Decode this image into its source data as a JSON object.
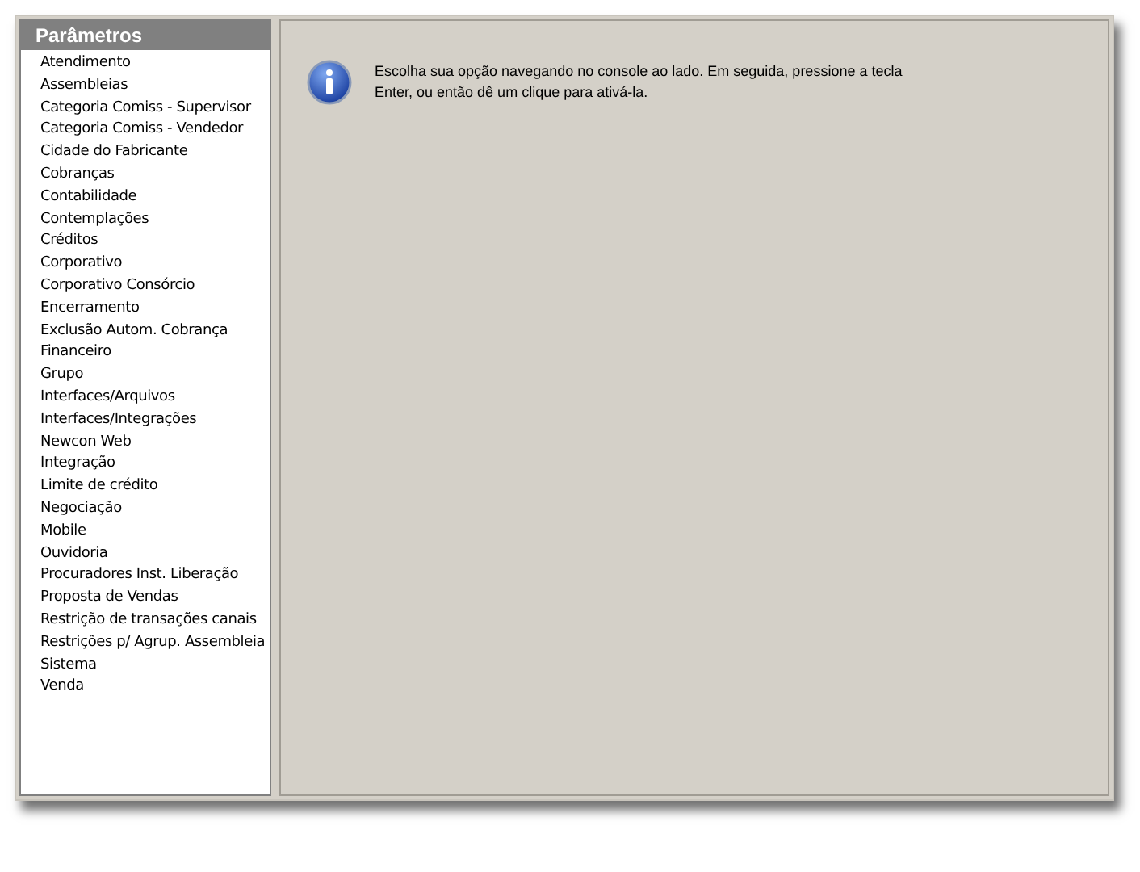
{
  "sidebar": {
    "title": "Parâmetros",
    "items": [
      {
        "label": "Atendimento"
      },
      {
        "label": "Assembleias"
      },
      {
        "label": "Categoria Comiss - Supervisor"
      },
      {
        "label": "Categoria Comiss - Vendedor"
      },
      {
        "label": "Cidade do Fabricante"
      },
      {
        "label": "Cobranças"
      },
      {
        "label": "Contabilidade"
      },
      {
        "label": "Contemplações"
      },
      {
        "label": "Créditos"
      },
      {
        "label": "Corporativo"
      },
      {
        "label": "Corporativo Consórcio"
      },
      {
        "label": "Encerramento"
      },
      {
        "label": "Exclusão Autom. Cobrança"
      },
      {
        "label": "Financeiro"
      },
      {
        "label": "Grupo"
      },
      {
        "label": "Interfaces/Arquivos"
      },
      {
        "label": "Interfaces/Integrações"
      },
      {
        "label": "Newcon Web"
      },
      {
        "label": "Integração"
      },
      {
        "label": "Limite de crédito"
      },
      {
        "label": "Negociação"
      },
      {
        "label": "Mobile"
      },
      {
        "label": "Ouvidoria"
      },
      {
        "label": "Procuradores Inst. Liberação"
      },
      {
        "label": "Proposta de Vendas"
      },
      {
        "label": "Restrição de transações canais"
      },
      {
        "label": "Restrições p/ Agrup. Assembleia"
      },
      {
        "label": "Sistema"
      },
      {
        "label": "Venda"
      }
    ]
  },
  "info": {
    "message": "Escolha sua opção navegando no console ao lado. Em seguida, pressione a tecla Enter, ou então dê um clique para ativá-la."
  }
}
